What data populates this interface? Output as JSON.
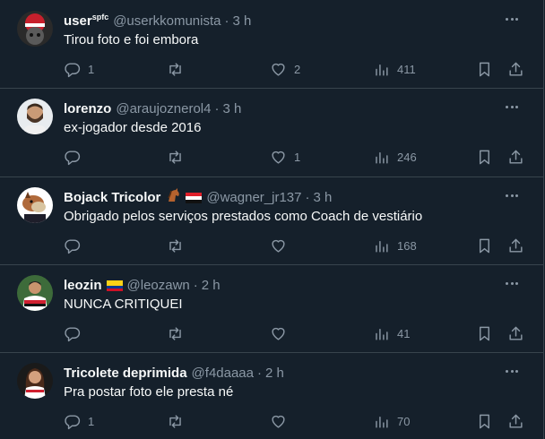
{
  "posts": [
    {
      "name": "user",
      "name_sup": "spfc",
      "handle": "@userkkomunista",
      "time": "3 h",
      "text": "Tirou foto e foi embora",
      "emojis": [],
      "avatar": "avatar-red-helmet",
      "replies": "1",
      "retweets": "",
      "likes": "2",
      "views": "411"
    },
    {
      "name": "lorenzo",
      "name_sup": "",
      "handle": "@araujoznerol4",
      "time": "3 h",
      "text": "ex-jogador desde 2016",
      "emojis": [],
      "avatar": "avatar-man-beard",
      "replies": "",
      "retweets": "",
      "likes": "1",
      "views": "246"
    },
    {
      "name": "Bojack Tricolor",
      "name_sup": "",
      "handle": "@wagner_jr137",
      "time": "3 h",
      "text": "Obrigado pelos serviços prestados como Coach de vestiário",
      "emojis": [
        "horse-emoji",
        "flag-red-white-black"
      ],
      "avatar": "avatar-bojack-horse",
      "replies": "",
      "retweets": "",
      "likes": "",
      "views": "168"
    },
    {
      "name": "leozin",
      "name_sup": "",
      "handle": "@leozawn",
      "time": "2 h",
      "text": "NUNCA CRITIQUEI",
      "emojis": [
        "flag-colombia"
      ],
      "avatar": "avatar-player-jersey",
      "replies": "",
      "retweets": "",
      "likes": "",
      "views": "41"
    },
    {
      "name": "Tricolete deprimida",
      "name_sup": "",
      "handle": "@f4daaaa",
      "time": "2 h",
      "text": "Pra postar foto ele presta né",
      "emojis": [],
      "avatar": "avatar-woman-jersey",
      "replies": "1",
      "retweets": "",
      "likes": "",
      "views": "70"
    }
  ],
  "separator": "·",
  "colors": {
    "background": "#15202b",
    "border": "#38444d",
    "muted": "#8b98a5",
    "text": "#f7f9f9"
  }
}
